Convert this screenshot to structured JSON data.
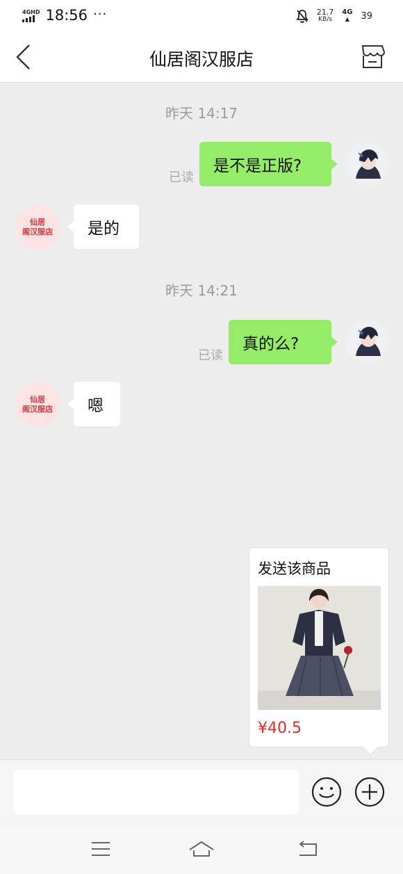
{
  "status_bar": {
    "network_tag": "4GHD",
    "time": "18:56",
    "more_dots": "···",
    "speed_value": "21.7",
    "speed_unit": "KB/s",
    "network_type": "4G",
    "battery": "39"
  },
  "header": {
    "title": "仙居阁汉服店"
  },
  "messages": [
    {
      "type": "timestamp",
      "text": "昨天 14:17"
    },
    {
      "type": "sent",
      "text": "是不是正版?",
      "read": "已读"
    },
    {
      "type": "received",
      "text": "是的"
    },
    {
      "type": "timestamp",
      "text": "昨天 14:21"
    },
    {
      "type": "sent",
      "text": "真的么?",
      "read": "已读"
    },
    {
      "type": "received",
      "text": "嗯"
    }
  ],
  "shop_avatar": {
    "line1": "仙居",
    "line2": "阁汉服店"
  },
  "product_card": {
    "title": "发送该商品",
    "price": "¥40.5"
  },
  "icons": {
    "back": "chevron-left-icon",
    "shop": "store-icon",
    "emoji": "smiley-icon",
    "plus": "plus-circle-icon",
    "menu": "menu-icon",
    "home": "home-icon",
    "return": "return-icon"
  },
  "colors": {
    "sent_bubble": "#95ec69",
    "received_bubble": "#ffffff",
    "background": "#ededed",
    "price": "#e02e24",
    "shop_avatar_text": "#d9363b"
  }
}
